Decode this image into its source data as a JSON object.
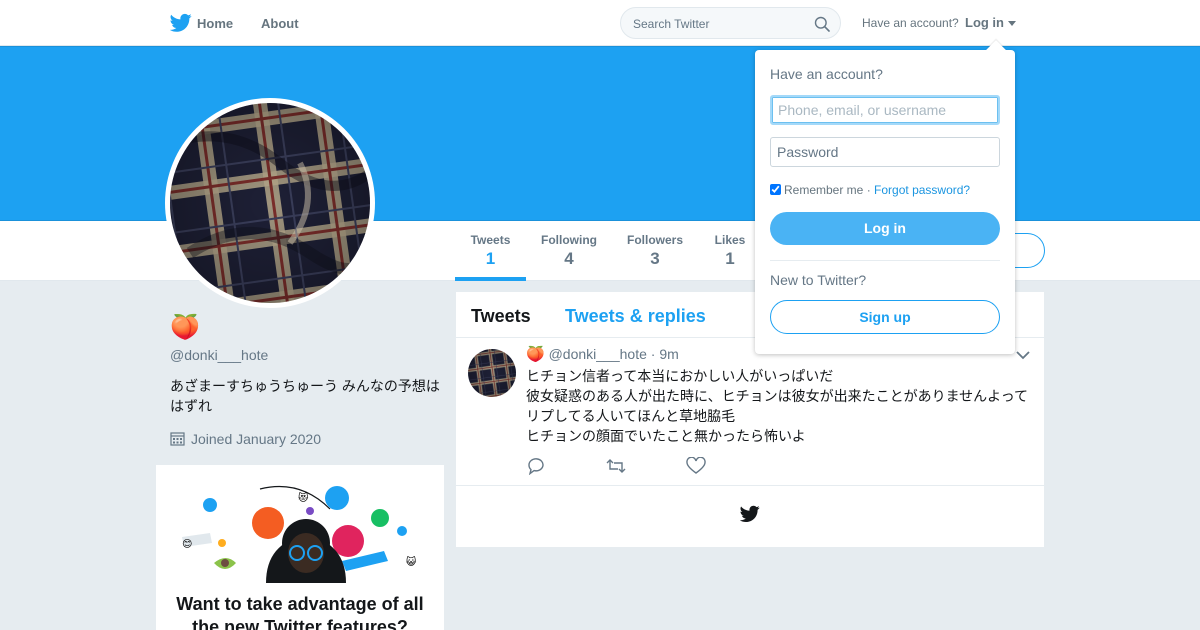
{
  "nav": {
    "home_label": "Home",
    "about_label": "About",
    "search_placeholder": "Search Twitter",
    "have_account": "Have an account?",
    "login_label": "Log in"
  },
  "profile": {
    "emoji": "🍑",
    "handle": "@donki___hote",
    "bio": "あざまーすちゅうちゅーう みんなの予想ははずれ",
    "joined": "Joined January 2020",
    "stats": [
      {
        "label": "Tweets",
        "value": "1"
      },
      {
        "label": "Following",
        "value": "4"
      },
      {
        "label": "Followers",
        "value": "3"
      },
      {
        "label": "Likes",
        "value": "1"
      }
    ]
  },
  "promo": {
    "text": "Want to take advantage of all the new Twitter features?"
  },
  "timeline": {
    "tabs": [
      "Tweets",
      "Tweets & replies"
    ],
    "tweet": {
      "emoji": "🍑",
      "handle": "@donki___hote",
      "separator": "·",
      "time": "9m",
      "lines": [
        "ヒチョン信者って本当におかしい人がいっぱいだ",
        "彼女疑惑のある人が出た時に、ヒチョンは彼女が出来たことがありませんよって",
        "リプしてる人いてほんと草地脇毛",
        "ヒチョンの顔面でいたこと無かったら怖いよ"
      ]
    }
  },
  "login_dropdown": {
    "title": "Have an account?",
    "username_placeholder": "Phone, email, or username",
    "password_placeholder": "Password",
    "remember_label": "Remember me",
    "separator": "·",
    "forgot_label": "Forgot password?",
    "login_button": "Log in",
    "new_label": "New to Twitter?",
    "signup_button": "Sign up"
  },
  "colors": {
    "brand": "#1da1f2",
    "background": "#e6ecf0"
  },
  "icons": [
    "twitter-bird-icon",
    "search-icon",
    "calendar-icon",
    "reply-icon",
    "retweet-icon",
    "like-icon",
    "chevron-down-icon"
  ]
}
